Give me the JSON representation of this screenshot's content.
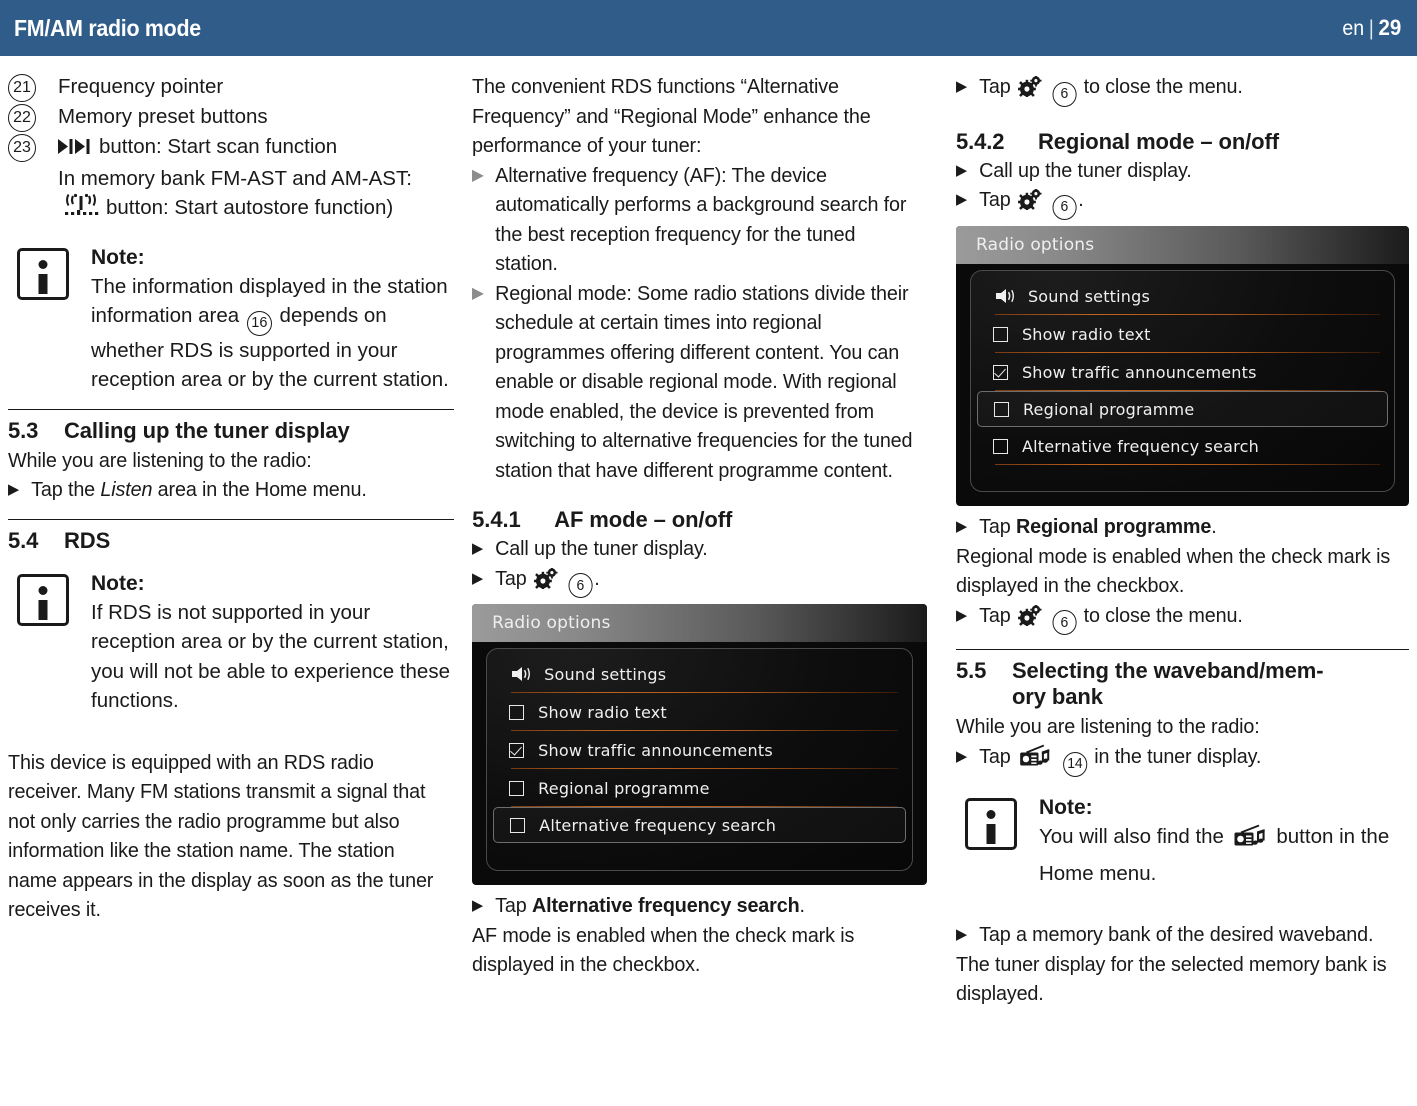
{
  "header": {
    "title": "FM/AM radio mode",
    "language": "en",
    "separator": "|",
    "page_number": "29"
  },
  "left_column": {
    "legend": [
      {
        "number": "21",
        "text": "Frequency pointer"
      },
      {
        "number": "22",
        "text": "Memory preset buttons"
      }
    ],
    "legend_23": {
      "number": "23",
      "line1_after_icon": "button: Start scan function",
      "line2": "In memory bank FM-AST and AM-AST:",
      "line3_after_icon": "button: Start autostore function)",
      "scan_icon": "scan-next-icon",
      "autostore_icon": "antenna-autostore-icon"
    },
    "note1": {
      "title": "Note:",
      "text_before": "The information displayed in the station information area",
      "ref": "16",
      "text_after": "depends on whether RDS is supported in your reception area or by the current station."
    },
    "section_5_3": {
      "number": "5.3",
      "title": "Calling up the tuner display",
      "intro": "While you are listening to the radio:",
      "steps": [
        {
          "before": "Tap the",
          "italic": "Listen",
          "after": "area in the Home menu."
        }
      ]
    },
    "section_5_4": {
      "number": "5.4",
      "title": "RDS"
    },
    "note2": {
      "title": "Note:",
      "text": "If RDS is not supported in your reception area or by the current station, you will not be able to experience these functions."
    },
    "paragraph": "This device is equipped with an RDS radio receiver. Many FM stations transmit a signal that not only carries the radio programme but also information like the station name. The station name appears in the display as soon as the tuner receives it."
  },
  "middle_column": {
    "intro": "The convenient RDS functions “Alternative Frequency” and “Regional Mode” enhance the performance of your tuner:",
    "bullets": [
      "Alternative frequency (AF): The device automatically performs a background search for the best reception frequency for the tuned station.",
      "Regional mode: Some radio stations divide their schedule at certain times into regional programmes offering different content. You can enable or disable regional mode. With regional mode enabled, the device is prevented from switching to alternative frequencies for the tuned station that have different programme content."
    ],
    "section_5_4_1": {
      "number": "5.4.1",
      "title": "AF mode – on/off",
      "steps": [
        {
          "text": "Call up the tuner display."
        },
        {
          "text_before": "Tap",
          "icon": "gear-icon",
          "ref": "6",
          "text_after": "."
        }
      ]
    },
    "device": {
      "title": "Radio options",
      "options": [
        {
          "label": "Sound settings",
          "type": "icon",
          "icon": "speaker-icon",
          "checked": false,
          "selected": false
        },
        {
          "label": "Show radio text",
          "type": "checkbox",
          "checked": false,
          "selected": false
        },
        {
          "label": "Show traffic announcements",
          "type": "checkbox",
          "checked": true,
          "selected": false
        },
        {
          "label": "Regional programme",
          "type": "checkbox",
          "checked": false,
          "selected": false
        },
        {
          "label": "Alternative frequency search",
          "type": "checkbox",
          "checked": false,
          "selected": true
        }
      ]
    },
    "after_device": {
      "step_before": "Tap",
      "step_bold": "Alternative frequency search",
      "step_after": ".",
      "result": "AF mode is enabled  when the check mark is displayed in the checkbox."
    }
  },
  "right_column": {
    "top_step": {
      "text_before": "Tap",
      "icon": "gear-icon",
      "ref": "6",
      "text_after": "to close the menu."
    },
    "section_5_4_2": {
      "number": "5.4.2",
      "title": "Regional mode – on/off",
      "steps": [
        {
          "text": "Call up the tuner display."
        },
        {
          "text_before": "Tap",
          "icon": "gear-icon",
          "ref": "6",
          "text_after": "."
        }
      ]
    },
    "device": {
      "title": "Radio options",
      "options": [
        {
          "label": "Sound settings",
          "type": "icon",
          "icon": "speaker-icon",
          "checked": false,
          "selected": false
        },
        {
          "label": "Show radio text",
          "type": "checkbox",
          "checked": false,
          "selected": false
        },
        {
          "label": "Show traffic announcements",
          "type": "checkbox",
          "checked": true,
          "selected": false
        },
        {
          "label": "Regional programme",
          "type": "checkbox",
          "checked": false,
          "selected": true
        },
        {
          "label": "Alternative frequency search",
          "type": "checkbox",
          "checked": false,
          "selected": false
        }
      ]
    },
    "after_device": {
      "step_before": "Tap",
      "step_bold": "Regional programme",
      "step_after": ".",
      "result": "Regional mode is enabled when the check mark is displayed in the checkbox.",
      "close_step": {
        "text_before": "Tap",
        "icon": "gear-icon",
        "ref": "6",
        "text_after": "to close the menu."
      }
    },
    "section_5_5": {
      "number": "5.5",
      "title_line1": "Selecting the waveband/mem-",
      "title_line2": "ory bank",
      "intro": "While you are listening to the radio:",
      "step": {
        "text_before": "Tap",
        "icon": "radio-icon",
        "ref": "14",
        "text_after": "in the tuner display."
      }
    },
    "note3": {
      "title": "Note:",
      "text_before": "You will also find the",
      "icon": "radio-icon",
      "text_after": "button in the Home menu."
    },
    "final_step": {
      "text": "Tap a memory bank of the desired waveband."
    },
    "final_result": "The tuner display for the selected memory bank is displayed."
  },
  "colors": {
    "header_blue": "#2f5c88",
    "text_black": "#1a1a1a",
    "bullet_gray": "#8c8c8c",
    "device_accent_orange": "#c8671e",
    "device_bg": "#0a0a0a"
  }
}
